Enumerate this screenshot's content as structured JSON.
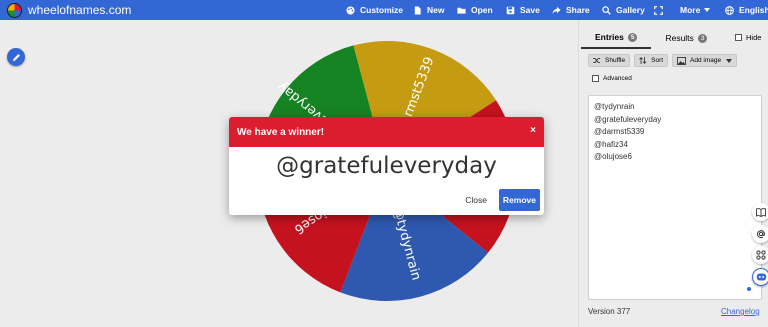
{
  "header": {
    "site_name": "wheelofnames.com",
    "nav": [
      {
        "label": "Customize",
        "icon": "palette-icon"
      },
      {
        "label": "New",
        "icon": "document-icon"
      },
      {
        "label": "Open",
        "icon": "folder-icon"
      },
      {
        "label": "Save",
        "icon": "floppy-icon"
      },
      {
        "label": "Share",
        "icon": "share-icon"
      },
      {
        "label": "Gallery",
        "icon": "search-icon"
      },
      {
        "label": "More",
        "icon": "chevron-down-icon"
      },
      {
        "label": "English",
        "icon": "globe-icon"
      }
    ]
  },
  "wheel": {
    "slices": [
      {
        "label": "@darmst5339",
        "color": "#c59b11"
      },
      {
        "label": "@hafiz34",
        "color": "#c5121f"
      },
      {
        "label": "@tydynrain",
        "color": "#2f59b0"
      },
      {
        "label": "@olujose6",
        "color": "#c5121f"
      },
      {
        "label": "@gratefuleveryday",
        "color": "#158321"
      }
    ]
  },
  "modal": {
    "title": "We have a winner!",
    "close_x": "×",
    "winner": "@gratefuleveryday",
    "close_label": "Close",
    "remove_label": "Remove"
  },
  "sidebar": {
    "tabs": [
      {
        "label": "Entries",
        "count": "5"
      },
      {
        "label": "Results",
        "count": "3"
      }
    ],
    "hide_label": "Hide",
    "shuffle_label": "Shuffle",
    "sort_label": "Sort",
    "add_image_label": "Add image",
    "advanced_label": "Advanced",
    "entries": [
      "@tydynrain",
      "@gratefuleveryday",
      "@darmst5339",
      "@hafiz34",
      "@olujose6"
    ],
    "version": "Version 377",
    "changelog": "Changelog"
  },
  "colors": {
    "brand_blue": "#3367d6",
    "winner_red": "#db1d2f"
  }
}
